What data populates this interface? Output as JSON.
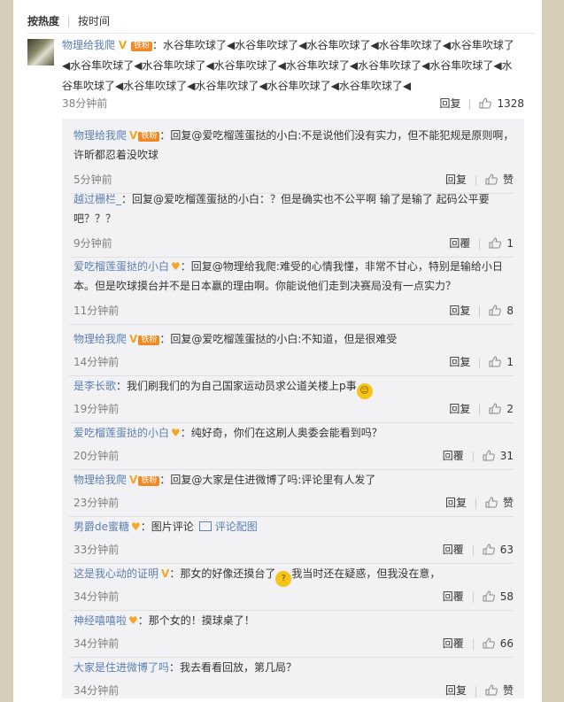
{
  "sort": {
    "hot": "按热度",
    "time": "按时间"
  },
  "top_comment": {
    "user": "物理给我爬",
    "v_badge": "V",
    "fan_badge": "铁粉",
    "separator": "：",
    "text": "水谷隼吹球了◀水谷隼吹球了◀水谷隼吹球了◀水谷隼吹球了◀水谷隼吹球了◀水谷隼吹球了◀水谷隼吹球了◀水谷隼吹球了◀水谷隼吹球了◀水谷隼吹球了◀水谷隼吹球了◀水谷隼吹球了◀水谷隼吹球了◀水谷隼吹球了◀水谷隼吹球了◀水谷隼吹球了◀",
    "time": "38分钟前",
    "reply_label": "回复",
    "likes": "1328"
  },
  "replies": [
    {
      "user": "物理给我爬",
      "badges": [
        "V",
        "铁粉"
      ],
      "body": "：回复@爱吃榴莲蛋挞的小白:不是说他们没有实力，但不能犯规是原则啊，许昕都忍着没吹球",
      "time": "5分钟前",
      "reply_label": "回复",
      "likes": "赞"
    },
    {
      "user": "越过栅栏_",
      "badges": [],
      "body": "：回复@爱吃榴莲蛋挞的小白：？但是确实也不公平啊  输了是输了  起码公平要吧？？？",
      "time": "9分钟前",
      "reply_label": "回覆",
      "likes": "1"
    },
    {
      "user": "爱吃榴莲蛋挞的小白",
      "badges": [
        "fan"
      ],
      "body": "：回复@物理给我爬:难受的心情我懂，非常不甘心，特别是输给小日本。但是吹球摸台并不是日本赢的理由啊。你能说他们走到决赛局没有一点实力？",
      "time": "11分钟前",
      "reply_label": "回复",
      "likes": "8"
    },
    {
      "user": "物理给我爬",
      "badges": [
        "V",
        "铁粉"
      ],
      "body": "：回复@爱吃榴莲蛋挞的小白:不知道，但是很难受",
      "time": "14分钟前",
      "reply_label": "回复",
      "likes": "1"
    },
    {
      "user": "是李长歌",
      "badges": [],
      "body": "：我们刷我们的为自己国家运动员求公道关楼上p事",
      "time": "19分钟前",
      "reply_label": "回复",
      "likes": "2"
    },
    {
      "user": "爱吃榴莲蛋挞的小白",
      "badges": [
        "fan"
      ],
      "body": "：纯好奇，你们在这刷人奥委会能看到吗？",
      "time": "20分钟前",
      "reply_label": "回覆",
      "likes": "31"
    },
    {
      "user": "物理给我爬",
      "badges": [
        "V",
        "铁粉"
      ],
      "body": "：回复@大家是住进微博了吗:评论里有人发了",
      "time": "23分钟前",
      "reply_label": "回复",
      "likes": "赞"
    },
    {
      "user": "男爵de蜜糖",
      "badges": [
        "fan"
      ],
      "body": "：图片评论",
      "picref": "评论配图",
      "time": "33分钟前",
      "reply_label": "回覆",
      "likes": "63"
    },
    {
      "user": "这是我心动的证明",
      "badges": [
        "V"
      ],
      "body": "：那女的好像还摸台了",
      "body2": "我当时还在疑惑，但我没在意，",
      "time": "34分钟前",
      "reply_label": "回覆",
      "likes": "58"
    },
    {
      "user": "神经嘻嘻啦",
      "badges": [
        "fan"
      ],
      "body": "：那个女的！摸球桌了！",
      "time": "34分钟前",
      "reply_label": "回覆",
      "likes": "66"
    },
    {
      "user": "大家是住进微博了吗",
      "badges": [],
      "body": "：我去看看回放，第几局？",
      "time": "34分钟前",
      "reply_label": "回复",
      "likes": "赞"
    }
  ],
  "colors": {
    "link": "#5b7fb0",
    "muted": "#808080",
    "badge": "#f5a623",
    "bg": "#d8cdb8"
  }
}
